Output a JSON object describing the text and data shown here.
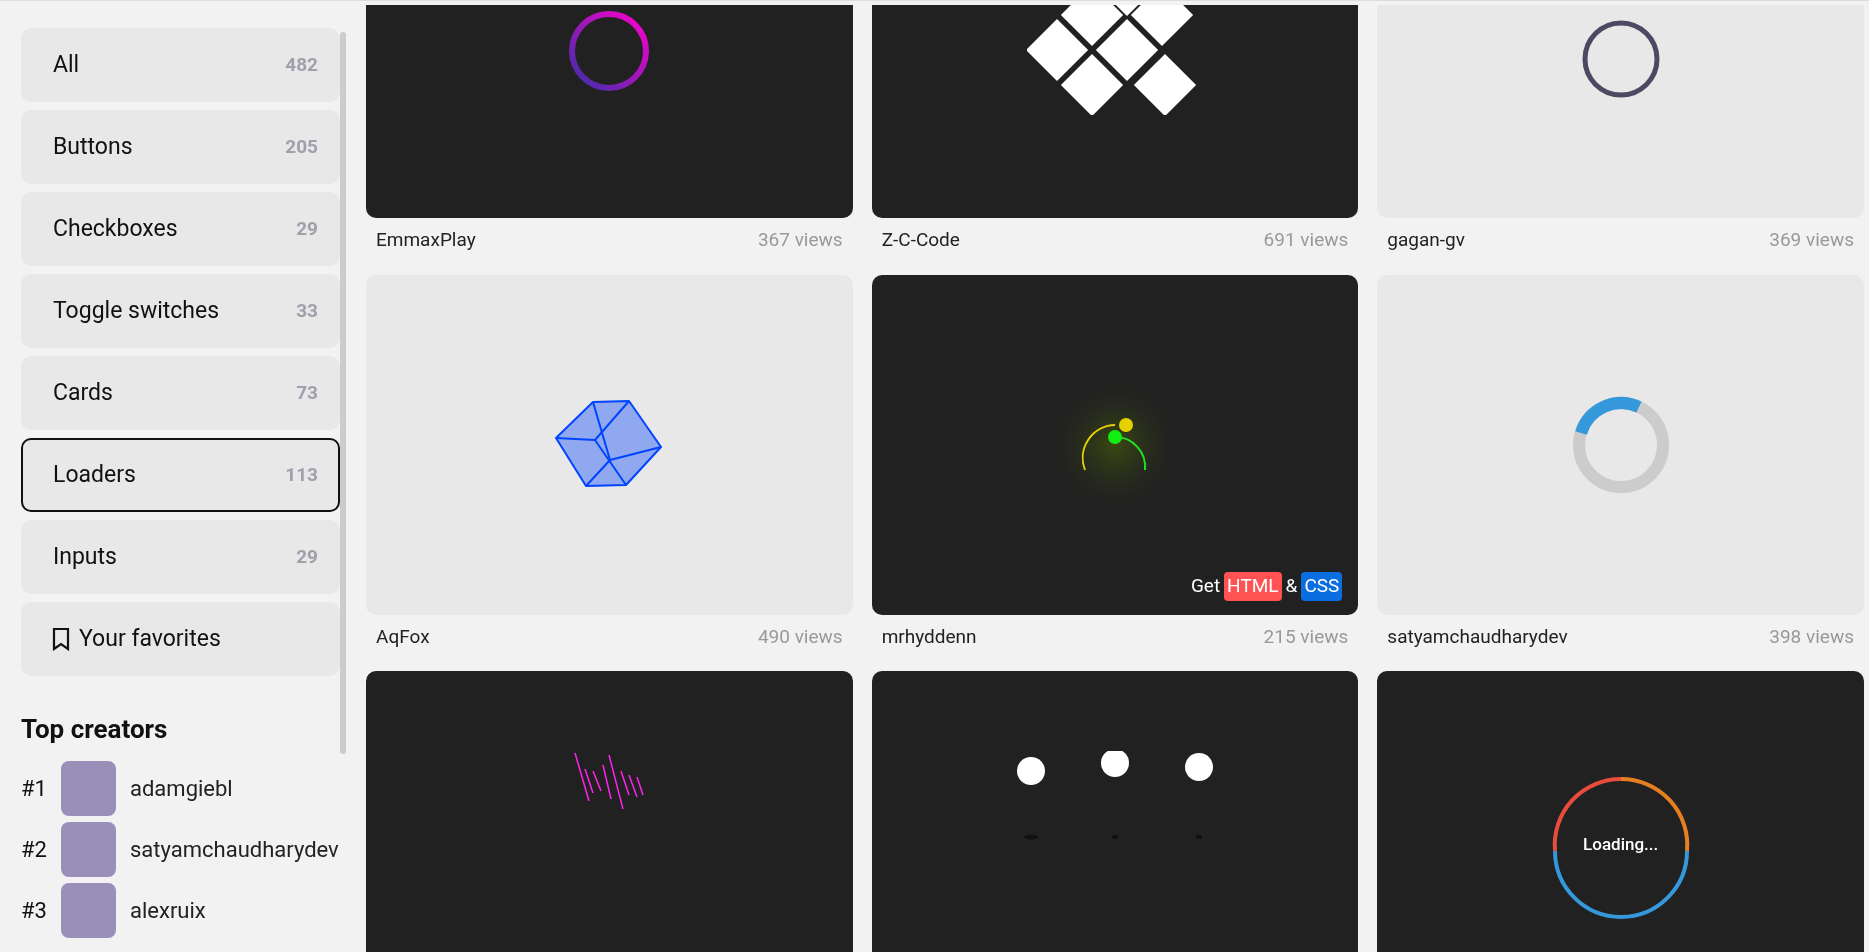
{
  "sidebar": {
    "categories": [
      {
        "label": "All",
        "count": "482",
        "selected": false
      },
      {
        "label": "Buttons",
        "count": "205",
        "selected": false
      },
      {
        "label": "Checkboxes",
        "count": "29",
        "selected": false
      },
      {
        "label": "Toggle switches",
        "count": "33",
        "selected": false
      },
      {
        "label": "Cards",
        "count": "73",
        "selected": false
      },
      {
        "label": "Loaders",
        "count": "113",
        "selected": true
      },
      {
        "label": "Inputs",
        "count": "29",
        "selected": false
      }
    ],
    "favorites": {
      "label": "Your favorites"
    },
    "top_creators": {
      "title": "Top creators",
      "items": [
        {
          "rank": "#1",
          "name": "adamgiebl"
        },
        {
          "rank": "#2",
          "name": "satyamchaudharydev"
        },
        {
          "rank": "#3",
          "name": "alexruix"
        }
      ]
    }
  },
  "cards": [
    {
      "kind": "gradient-ring",
      "dark": true,
      "author": "EmmaxPlay",
      "views": "367 views"
    },
    {
      "kind": "diamonds",
      "dark": true,
      "author": "Z-C-Code",
      "views": "691 views"
    },
    {
      "kind": "ring",
      "dark": false,
      "author": "gagan-gv",
      "views": "369 views"
    },
    {
      "kind": "cube",
      "dark": false,
      "author": "AqFox",
      "views": "490 views"
    },
    {
      "kind": "orbit",
      "dark": true,
      "author": "mrhyddenn",
      "views": "215 views",
      "badge": {
        "prefix": "Get",
        "html": "HTML",
        "joiner": "&",
        "css": "CSS"
      }
    },
    {
      "kind": "spinner",
      "dark": false,
      "author": "satyamchaudharydev",
      "views": "398 views"
    },
    {
      "kind": "strokes",
      "dark": true
    },
    {
      "kind": "dots",
      "dark": true
    },
    {
      "kind": "loading-ring",
      "dark": true,
      "text": "Loading..."
    }
  ]
}
